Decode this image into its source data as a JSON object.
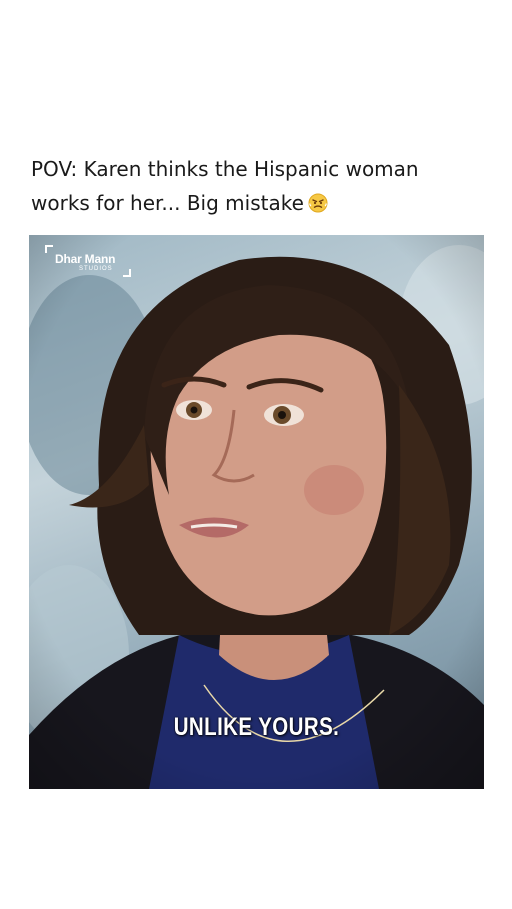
{
  "post": {
    "caption_line1": "POV: Karen thinks the Hispanic woman",
    "caption_line2": "works for her... Big mistake",
    "caption_emoji": "angry-face-emoji"
  },
  "video": {
    "logo": {
      "brand": "Dhar Mann",
      "sub": "STUDIOS"
    },
    "subtitle": "UNLIKE YOURS."
  }
}
